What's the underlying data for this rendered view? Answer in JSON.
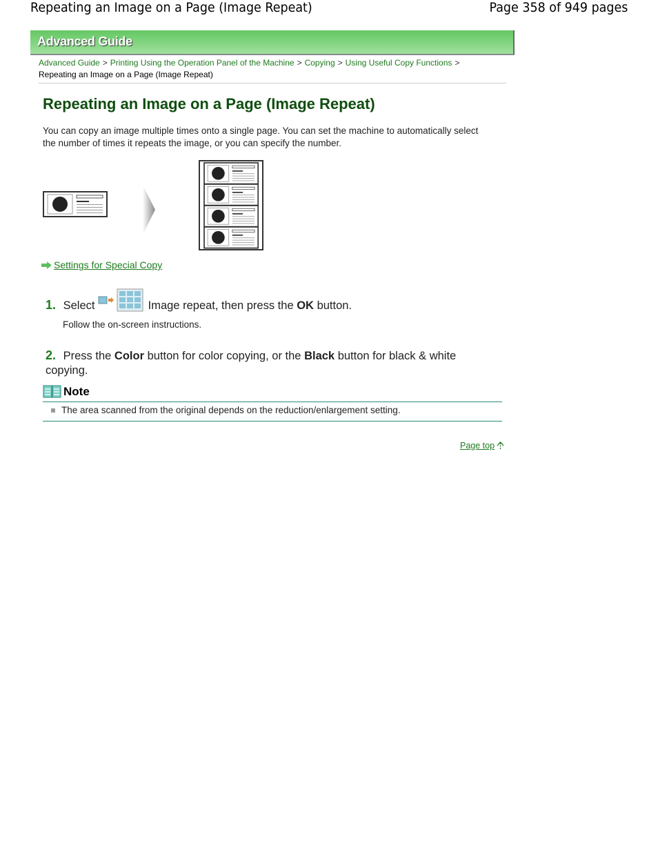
{
  "header": {
    "title": "Repeating an Image on a Page (Image Repeat)",
    "page_indicator": "Page 358 of 949 pages"
  },
  "banner": {
    "label": "Advanced Guide"
  },
  "breadcrumb": {
    "items": [
      "Advanced Guide",
      "Printing Using the Operation Panel of the Machine",
      "Copying",
      "Using Useful Copy Functions"
    ],
    "current": "Repeating an Image on a Page (Image Repeat)",
    "separator": ">"
  },
  "main": {
    "title": "Repeating an Image on a Page (Image Repeat)",
    "intro": "You can copy an image multiple times onto a single page. You can set the machine to automatically select the number of times it repeats the image, or you can specify the number.",
    "related_link": "Settings for Special Copy",
    "steps": [
      {
        "number": "1.",
        "pre": "Select",
        "post": "Image repeat, then press the",
        "bold": "OK",
        "end": "button.",
        "sub": "Follow the on-screen instructions."
      },
      {
        "number": "2.",
        "pre": "Press the",
        "bold1": "Color",
        "mid": "button for color copying, or the",
        "bold2": "Black",
        "end": "button for black & white copying."
      }
    ],
    "note": {
      "title": "Note",
      "items": [
        "The area scanned from the original depends on the reduction/enlargement setting."
      ]
    },
    "page_top": "Page top"
  }
}
